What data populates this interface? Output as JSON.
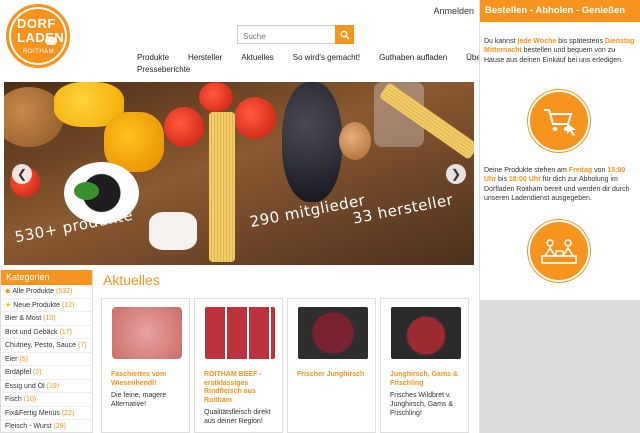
{
  "header": {
    "logo": {
      "line1": "DORF",
      "line2": "LADEN",
      "line3": "ROITHAM"
    },
    "login_label": "Anmelden",
    "search": {
      "placeholder": "Suche"
    },
    "nav": [
      "Produkte",
      "Hersteller",
      "Aktuelles",
      "So wird's gemacht!",
      "Guthaben aufladen",
      "Über Uns"
    ],
    "nav_row2": [
      "Presseberichte"
    ]
  },
  "hero": {
    "text_products": "530+ produkte",
    "text_members": "290 mitglieder",
    "text_producers": "33 hersteller"
  },
  "categories": {
    "title": "Kategorien",
    "items": [
      {
        "label": "Alle Produkte",
        "count": "(532)",
        "icon": "tag-icon"
      },
      {
        "label": "Neue Produkte",
        "count": "(12)",
        "icon": "star-icon"
      },
      {
        "label": "Bier & Most",
        "count": "(10)"
      },
      {
        "label": "Brot und Gebäck",
        "count": "(17)"
      },
      {
        "label": "Chutney, Pesto, Sauce",
        "count": "(7)"
      },
      {
        "label": "Eier",
        "count": "(5)"
      },
      {
        "label": "Erdäpfel",
        "count": "(2)"
      },
      {
        "label": "Essig und Öl",
        "count": "(19)"
      },
      {
        "label": "Fisch",
        "count": "(10)"
      },
      {
        "label": "Fix&Fertig Menüs",
        "count": "(22)"
      },
      {
        "label": "Fleisch - Wurst",
        "count": "(29)"
      }
    ]
  },
  "news": {
    "title": "Aktuelles",
    "cards": [
      {
        "title": "Faschiertes vom Wiesenhendl!",
        "desc": "Die feine, magere Alternative!"
      },
      {
        "title": "ROITHAM BEEF - erstklassiges Rindfleisch aus Roitham",
        "desc": "Qualitätsfleisch direkt aus deiner Region!"
      },
      {
        "title": "Frischer Junghirsch",
        "desc": ""
      },
      {
        "title": "Junghirsch, Gams & Frischling",
        "desc": "Frisches Wildbret v. Junghirsch, Gams & Frischling!"
      }
    ]
  },
  "right_panel": {
    "title": "Bestellen - Abholen - Genießen",
    "p1": {
      "a": "Du kannst ",
      "b": "jede Woche",
      "c": " bis spätestens ",
      "d": "Dienstag Mitternacht",
      "e": " bestellen und bequem von zu Hause aus deinen Einkauf bei uns erledigen."
    },
    "p2": {
      "a": "Deine Produkte stehen am ",
      "b": "Freitag",
      "c": " von ",
      "d": "15:00 Uhr",
      "e": " bis ",
      "f": "18:00 Uhr",
      "g": " für dich zur Abholung im Dorfladen Roitham bereit und werden dir durch unseren Ladendienst ausgegeben."
    }
  },
  "colors": {
    "accent": "#f7941d"
  }
}
